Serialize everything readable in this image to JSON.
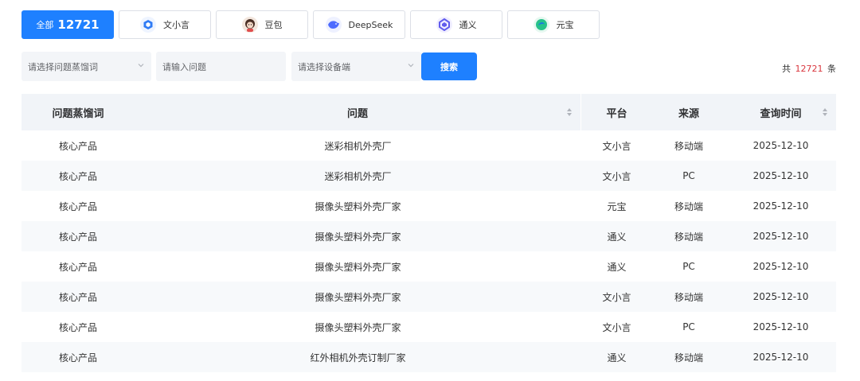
{
  "tabs": {
    "all": {
      "label": "全部",
      "count": "12721"
    },
    "items": [
      {
        "label": "文小言",
        "icon": "wenxiaoyan-icon"
      },
      {
        "label": "豆包",
        "icon": "doubao-icon"
      },
      {
        "label": "DeepSeek",
        "icon": "deepseek-icon"
      },
      {
        "label": "通义",
        "icon": "tongyi-icon"
      },
      {
        "label": "元宝",
        "icon": "yuanbao-icon"
      }
    ]
  },
  "filters": {
    "keyword_placeholder": "请选择问题蒸馏词",
    "question_placeholder": "请输入问题",
    "device_placeholder": "请选择设备端",
    "search_label": "搜索"
  },
  "total": {
    "prefix": "共",
    "count": "12721",
    "suffix": "条"
  },
  "table": {
    "headers": [
      "问题蒸馏词",
      "问题",
      "平台",
      "来源",
      "查询时间"
    ],
    "rows": [
      [
        "核心产品",
        "迷彩相机外壳厂",
        "文小言",
        "移动端",
        "2025-12-10"
      ],
      [
        "核心产品",
        "迷彩相机外壳厂",
        "文小言",
        "PC",
        "2025-12-10"
      ],
      [
        "核心产品",
        "摄像头塑料外壳厂家",
        "元宝",
        "移动端",
        "2025-12-10"
      ],
      [
        "核心产品",
        "摄像头塑料外壳厂家",
        "通义",
        "移动端",
        "2025-12-10"
      ],
      [
        "核心产品",
        "摄像头塑料外壳厂家",
        "通义",
        "PC",
        "2025-12-10"
      ],
      [
        "核心产品",
        "摄像头塑料外壳厂家",
        "文小言",
        "移动端",
        "2025-12-10"
      ],
      [
        "核心产品",
        "摄像头塑料外壳厂家",
        "文小言",
        "PC",
        "2025-12-10"
      ],
      [
        "核心产品",
        "红外相机外壳订制厂家",
        "通义",
        "移动端",
        "2025-12-10"
      ]
    ]
  },
  "colors": {
    "accent": "#1e80ff",
    "total_count": "#d9363e"
  }
}
